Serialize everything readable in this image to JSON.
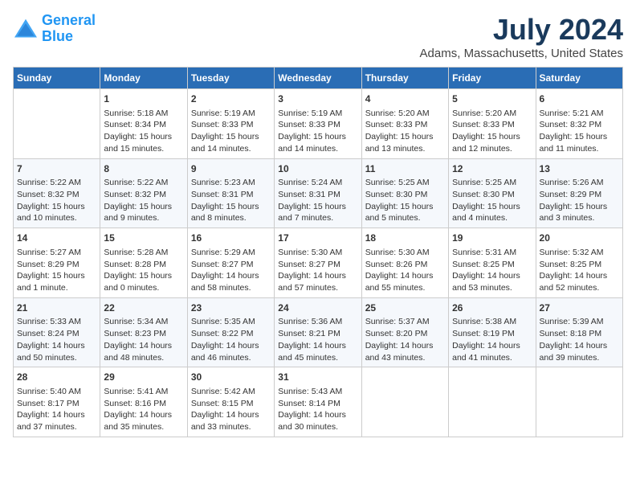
{
  "logo": {
    "line1": "General",
    "line2": "Blue"
  },
  "title": "July 2024",
  "subtitle": "Adams, Massachusetts, United States",
  "header": {
    "days": [
      "Sunday",
      "Monday",
      "Tuesday",
      "Wednesday",
      "Thursday",
      "Friday",
      "Saturday"
    ]
  },
  "weeks": [
    {
      "cells": [
        {
          "day": "",
          "info": ""
        },
        {
          "day": "1",
          "info": "Sunrise: 5:18 AM\nSunset: 8:34 PM\nDaylight: 15 hours\nand 15 minutes."
        },
        {
          "day": "2",
          "info": "Sunrise: 5:19 AM\nSunset: 8:33 PM\nDaylight: 15 hours\nand 14 minutes."
        },
        {
          "day": "3",
          "info": "Sunrise: 5:19 AM\nSunset: 8:33 PM\nDaylight: 15 hours\nand 14 minutes."
        },
        {
          "day": "4",
          "info": "Sunrise: 5:20 AM\nSunset: 8:33 PM\nDaylight: 15 hours\nand 13 minutes."
        },
        {
          "day": "5",
          "info": "Sunrise: 5:20 AM\nSunset: 8:33 PM\nDaylight: 15 hours\nand 12 minutes."
        },
        {
          "day": "6",
          "info": "Sunrise: 5:21 AM\nSunset: 8:32 PM\nDaylight: 15 hours\nand 11 minutes."
        }
      ]
    },
    {
      "cells": [
        {
          "day": "7",
          "info": "Sunrise: 5:22 AM\nSunset: 8:32 PM\nDaylight: 15 hours\nand 10 minutes."
        },
        {
          "day": "8",
          "info": "Sunrise: 5:22 AM\nSunset: 8:32 PM\nDaylight: 15 hours\nand 9 minutes."
        },
        {
          "day": "9",
          "info": "Sunrise: 5:23 AM\nSunset: 8:31 PM\nDaylight: 15 hours\nand 8 minutes."
        },
        {
          "day": "10",
          "info": "Sunrise: 5:24 AM\nSunset: 8:31 PM\nDaylight: 15 hours\nand 7 minutes."
        },
        {
          "day": "11",
          "info": "Sunrise: 5:25 AM\nSunset: 8:30 PM\nDaylight: 15 hours\nand 5 minutes."
        },
        {
          "day": "12",
          "info": "Sunrise: 5:25 AM\nSunset: 8:30 PM\nDaylight: 15 hours\nand 4 minutes."
        },
        {
          "day": "13",
          "info": "Sunrise: 5:26 AM\nSunset: 8:29 PM\nDaylight: 15 hours\nand 3 minutes."
        }
      ]
    },
    {
      "cells": [
        {
          "day": "14",
          "info": "Sunrise: 5:27 AM\nSunset: 8:29 PM\nDaylight: 15 hours\nand 1 minute."
        },
        {
          "day": "15",
          "info": "Sunrise: 5:28 AM\nSunset: 8:28 PM\nDaylight: 15 hours\nand 0 minutes."
        },
        {
          "day": "16",
          "info": "Sunrise: 5:29 AM\nSunset: 8:27 PM\nDaylight: 14 hours\nand 58 minutes."
        },
        {
          "day": "17",
          "info": "Sunrise: 5:30 AM\nSunset: 8:27 PM\nDaylight: 14 hours\nand 57 minutes."
        },
        {
          "day": "18",
          "info": "Sunrise: 5:30 AM\nSunset: 8:26 PM\nDaylight: 14 hours\nand 55 minutes."
        },
        {
          "day": "19",
          "info": "Sunrise: 5:31 AM\nSunset: 8:25 PM\nDaylight: 14 hours\nand 53 minutes."
        },
        {
          "day": "20",
          "info": "Sunrise: 5:32 AM\nSunset: 8:25 PM\nDaylight: 14 hours\nand 52 minutes."
        }
      ]
    },
    {
      "cells": [
        {
          "day": "21",
          "info": "Sunrise: 5:33 AM\nSunset: 8:24 PM\nDaylight: 14 hours\nand 50 minutes."
        },
        {
          "day": "22",
          "info": "Sunrise: 5:34 AM\nSunset: 8:23 PM\nDaylight: 14 hours\nand 48 minutes."
        },
        {
          "day": "23",
          "info": "Sunrise: 5:35 AM\nSunset: 8:22 PM\nDaylight: 14 hours\nand 46 minutes."
        },
        {
          "day": "24",
          "info": "Sunrise: 5:36 AM\nSunset: 8:21 PM\nDaylight: 14 hours\nand 45 minutes."
        },
        {
          "day": "25",
          "info": "Sunrise: 5:37 AM\nSunset: 8:20 PM\nDaylight: 14 hours\nand 43 minutes."
        },
        {
          "day": "26",
          "info": "Sunrise: 5:38 AM\nSunset: 8:19 PM\nDaylight: 14 hours\nand 41 minutes."
        },
        {
          "day": "27",
          "info": "Sunrise: 5:39 AM\nSunset: 8:18 PM\nDaylight: 14 hours\nand 39 minutes."
        }
      ]
    },
    {
      "cells": [
        {
          "day": "28",
          "info": "Sunrise: 5:40 AM\nSunset: 8:17 PM\nDaylight: 14 hours\nand 37 minutes."
        },
        {
          "day": "29",
          "info": "Sunrise: 5:41 AM\nSunset: 8:16 PM\nDaylight: 14 hours\nand 35 minutes."
        },
        {
          "day": "30",
          "info": "Sunrise: 5:42 AM\nSunset: 8:15 PM\nDaylight: 14 hours\nand 33 minutes."
        },
        {
          "day": "31",
          "info": "Sunrise: 5:43 AM\nSunset: 8:14 PM\nDaylight: 14 hours\nand 30 minutes."
        },
        {
          "day": "",
          "info": ""
        },
        {
          "day": "",
          "info": ""
        },
        {
          "day": "",
          "info": ""
        }
      ]
    }
  ]
}
